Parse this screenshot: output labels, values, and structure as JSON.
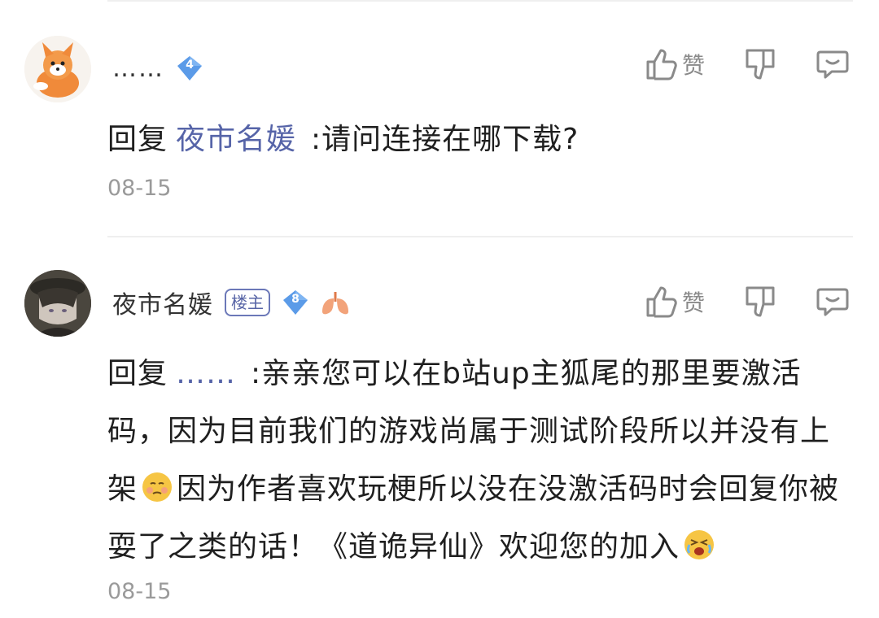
{
  "comments": [
    {
      "username": "……",
      "level": "4",
      "like_label": "赞",
      "reply_prefix": "回复",
      "reply_to": "夜市名媛",
      "text": ":请问连接在哪下载?",
      "date": "08-15",
      "avatar_icon": "fox-avatar"
    },
    {
      "username": "夜市名媛",
      "badge": "楼主",
      "level": "8",
      "like_label": "赞",
      "reply_prefix": "回复",
      "reply_to": "……",
      "text_part1": ":亲亲您可以在b站up主狐尾的那里要激活码，因为目前我们的游戏尚属于测试阶段所以并没有上架",
      "text_part2": "因为作者喜欢玩梗所以没在没激活码时会回复你被耍了之类的话！《道诡异仙》欢迎您的加入",
      "date": "08-15",
      "avatar_icon": "anime-character-avatar"
    }
  ],
  "colors": {
    "mention": "#5664a8",
    "level_badge": "#5b9be8",
    "date": "#9a9a9a",
    "icon": "#8a8a8a"
  }
}
